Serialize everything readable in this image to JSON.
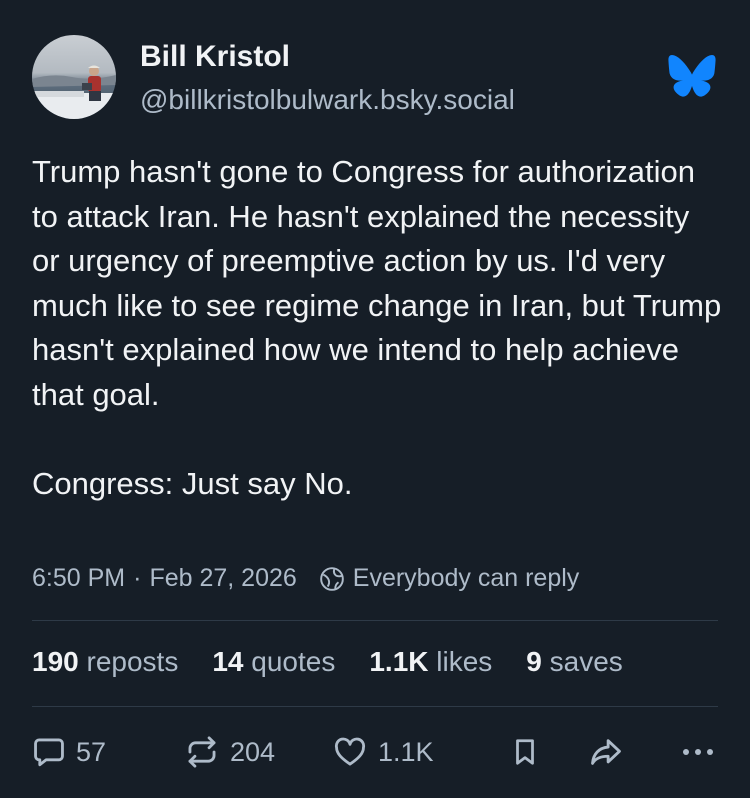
{
  "author": {
    "display_name": "Bill Kristol",
    "handle": "@billkristolbulwark.bsky.social"
  },
  "post": {
    "paragraphs": [
      "Trump hasn't gone to Congress for authorization to attack Iran. He hasn't explained the necessity or urgency of preemptive action by us. I'd very much like to see regime change in Iran, but Trump hasn't explained how we intend to help achieve that goal.",
      "Congress: Just say No."
    ],
    "time": "6:50 PM",
    "separator": "·",
    "date": "Feb 27, 2026",
    "reply_setting": "Everybody can reply"
  },
  "stats": {
    "reposts_count": "190",
    "reposts_label": "reposts",
    "quotes_count": "14",
    "quotes_label": "quotes",
    "likes_count": "1.1K",
    "likes_label": "likes",
    "saves_count": "9",
    "saves_label": "saves"
  },
  "actions": {
    "reply_count": "57",
    "repost_count": "204",
    "like_count": "1.1K"
  },
  "icons": {
    "brand": "bluesky-butterfly-icon",
    "reply": "speech-bubble-icon",
    "repost": "repost-arrows-icon",
    "like": "heart-icon",
    "bookmark": "bookmark-icon",
    "share": "share-arrow-icon",
    "more": "ellipsis-icon",
    "globe": "globe-icon"
  },
  "colors": {
    "background": "#161e27",
    "text": "#f1f3f5",
    "muted": "#aebbc9",
    "brand_blue": "#1185fe",
    "divider": "#2e3a47"
  }
}
